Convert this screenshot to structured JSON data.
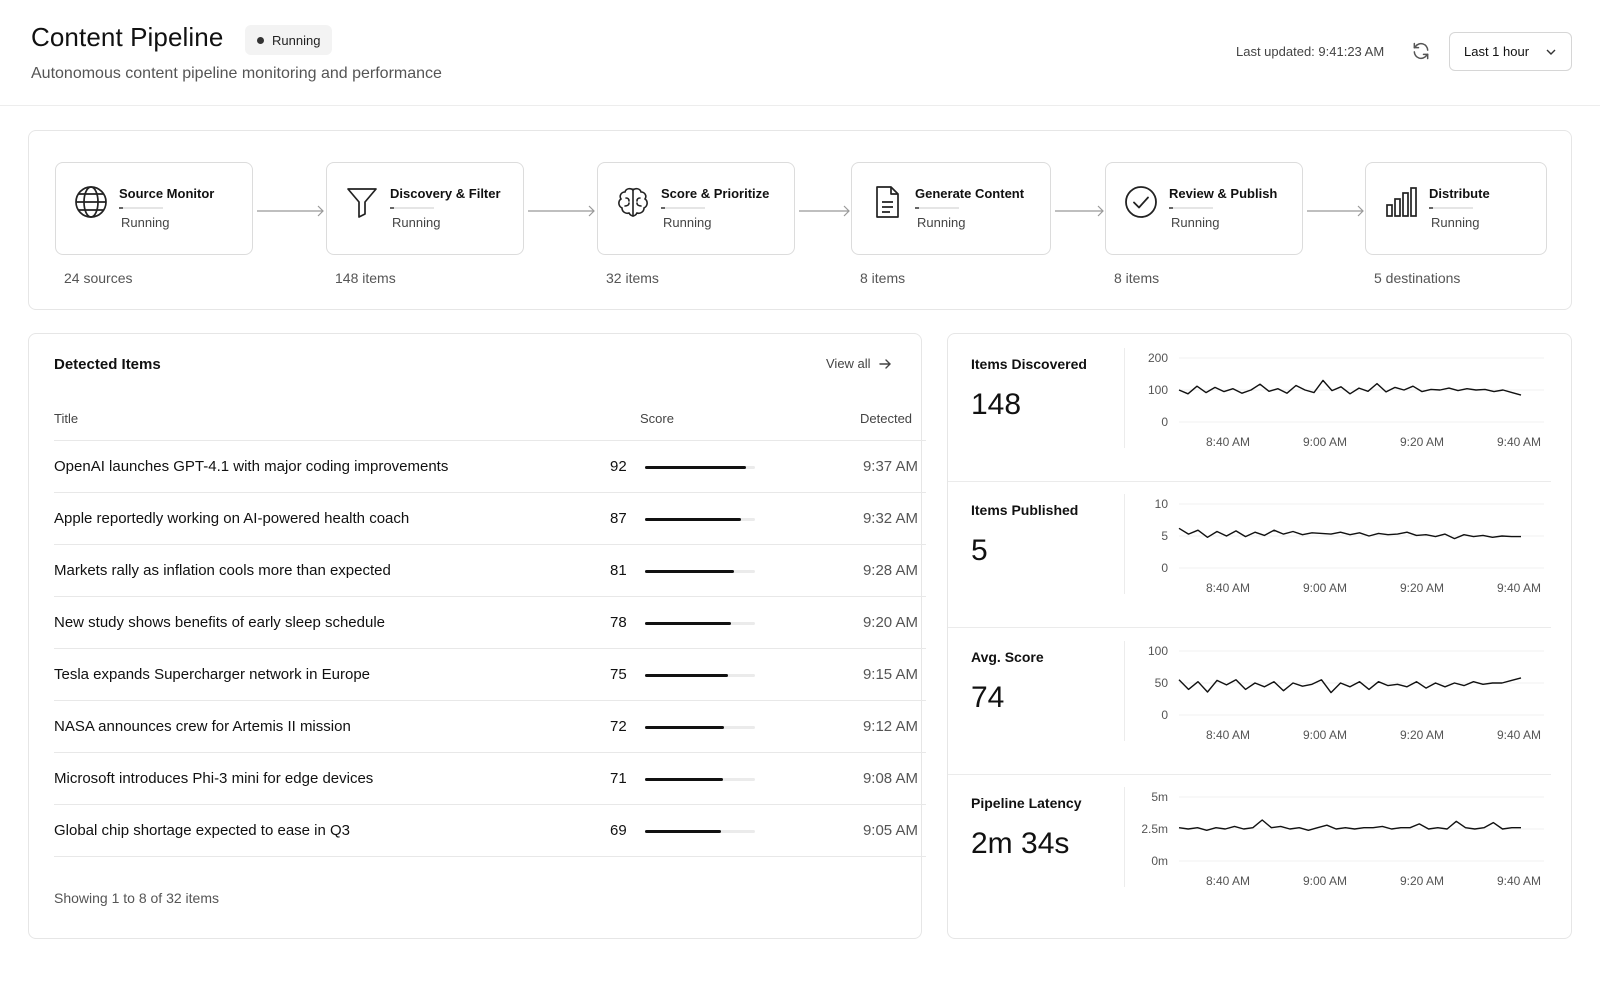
{
  "header": {
    "title": "Content Pipeline",
    "status": "Running",
    "subtitle": "Autonomous content pipeline monitoring and performance",
    "last_updated": "Last updated: 9:41:23 AM",
    "time_range": "Last 1 hour"
  },
  "pipeline": {
    "stages": [
      {
        "name": "Source Monitor",
        "status": "Running",
        "count": "24 sources",
        "icon": "globe-icon",
        "progress": 0.1
      },
      {
        "name": "Discovery & Filter",
        "status": "Running",
        "count": "148 items",
        "icon": "filter-icon",
        "progress": 0.1
      },
      {
        "name": "Score & Prioritize",
        "status": "Running",
        "count": "32 items",
        "icon": "brain-icon",
        "progress": 0.1
      },
      {
        "name": "Generate Content",
        "status": "Running",
        "count": "8 items",
        "icon": "document-icon",
        "progress": 0.1
      },
      {
        "name": "Review & Publish",
        "status": "Running",
        "count": "8 items",
        "icon": "check-circle-icon",
        "progress": 0.1
      },
      {
        "name": "Distribute",
        "status": "Running",
        "count": "5 destinations",
        "icon": "bar-chart-icon",
        "progress": 0.1
      }
    ]
  },
  "detected_items": {
    "title": "Detected Items",
    "view_all": "View all",
    "columns": {
      "title": "Title",
      "score": "Score",
      "detected": "Detected"
    },
    "rows": [
      {
        "title": "OpenAI launches GPT-4.1 with major coding improvements",
        "score": "92",
        "detected": "9:37 AM",
        "score_fraction": 0.92
      },
      {
        "title": "Apple reportedly working on AI-powered health coach",
        "score": "87",
        "detected": "9:32 AM",
        "score_fraction": 0.87
      },
      {
        "title": "Markets rally as inflation cools more than expected",
        "score": "81",
        "detected": "9:28 AM",
        "score_fraction": 0.81
      },
      {
        "title": "New study shows benefits of early sleep schedule",
        "score": "78",
        "detected": "9:20 AM",
        "score_fraction": 0.78
      },
      {
        "title": "Tesla expands Supercharger network in Europe",
        "score": "75",
        "detected": "9:15 AM",
        "score_fraction": 0.75
      },
      {
        "title": "NASA announces crew for Artemis II mission",
        "score": "72",
        "detected": "9:12 AM",
        "score_fraction": 0.72
      },
      {
        "title": "Microsoft introduces Phi-3 mini for edge devices",
        "score": "71",
        "detected": "9:08 AM",
        "score_fraction": 0.71
      },
      {
        "title": "Global chip shortage expected to ease in Q3",
        "score": "69",
        "detected": "9:05 AM",
        "score_fraction": 0.69
      }
    ],
    "footer": "Showing 1 to 8 of 32 items"
  },
  "metrics": [
    {
      "label": "Items Discovered",
      "value": "148"
    },
    {
      "label": "Items Published",
      "value": "5"
    },
    {
      "label": "Avg. Score",
      "value": "74"
    },
    {
      "label": "Pipeline Latency",
      "value": "2m 34s"
    }
  ],
  "chart_data": [
    {
      "type": "line",
      "title": "Items Discovered",
      "x": [
        "8:40 AM",
        "9:00 AM",
        "9:20 AM",
        "9:40 AM"
      ],
      "y_ticks": [
        "200",
        "100",
        "0"
      ],
      "ylim": [
        0,
        200
      ],
      "series": [
        {
          "values": [
            100,
            88,
            112,
            92,
            108,
            95,
            104,
            90,
            100,
            118,
            96,
            104,
            90,
            114,
            100,
            92,
            130,
            98,
            110,
            88,
            106,
            96,
            120,
            94,
            108,
            100,
            112,
            95,
            102,
            100,
            106,
            98,
            104,
            100,
            102,
            95,
            100,
            92,
            84
          ]
        }
      ]
    },
    {
      "type": "line",
      "title": "Items Published",
      "x": [
        "8:40 AM",
        "9:00 AM",
        "9:20 AM",
        "9:40 AM"
      ],
      "y_ticks": [
        "10",
        "5",
        "0"
      ],
      "ylim": [
        0,
        10
      ],
      "series": [
        {
          "values": [
            6.2,
            5.3,
            5.9,
            4.8,
            5.7,
            5.0,
            5.8,
            4.9,
            5.6,
            5.1,
            5.9,
            5.3,
            5.7,
            5.2,
            5.5,
            5.4,
            5.3,
            5.6,
            5.2,
            5.5,
            5.0,
            5.4,
            5.2,
            5.3,
            5.6,
            5.1,
            5.2,
            4.9,
            5.3,
            4.6,
            5.2,
            4.9,
            5.1,
            4.8,
            5.0,
            4.9,
            4.9
          ]
        }
      ]
    },
    {
      "type": "line",
      "title": "Avg. Score",
      "x": [
        "8:40 AM",
        "9:00 AM",
        "9:20 AM",
        "9:40 AM"
      ],
      "y_ticks": [
        "100",
        "50",
        "0"
      ],
      "ylim": [
        0,
        100
      ],
      "series": [
        {
          "values": [
            55,
            40,
            52,
            36,
            54,
            47,
            55,
            40,
            50,
            44,
            52,
            38,
            50,
            45,
            48,
            55,
            35,
            50,
            44,
            52,
            40,
            52,
            46,
            48,
            44,
            52,
            42,
            50,
            44,
            50,
            46,
            52,
            48,
            50,
            50,
            54,
            58
          ]
        }
      ]
    },
    {
      "type": "line",
      "title": "Pipeline Latency",
      "x": [
        "8:40 AM",
        "9:00 AM",
        "9:20 AM",
        "9:40 AM"
      ],
      "y_ticks": [
        "5m",
        "2.5m",
        "0m"
      ],
      "ylim": [
        0,
        5
      ],
      "series": [
        {
          "values": [
            2.6,
            2.5,
            2.6,
            2.4,
            2.6,
            2.5,
            2.7,
            2.5,
            2.6,
            3.2,
            2.6,
            2.7,
            2.5,
            2.6,
            2.4,
            2.6,
            2.8,
            2.5,
            2.6,
            2.5,
            2.6,
            2.6,
            2.7,
            2.5,
            2.6,
            2.6,
            2.9,
            2.5,
            2.6,
            2.5,
            3.1,
            2.6,
            2.5,
            2.6,
            3.0,
            2.5,
            2.6,
            2.6
          ]
        }
      ]
    }
  ]
}
